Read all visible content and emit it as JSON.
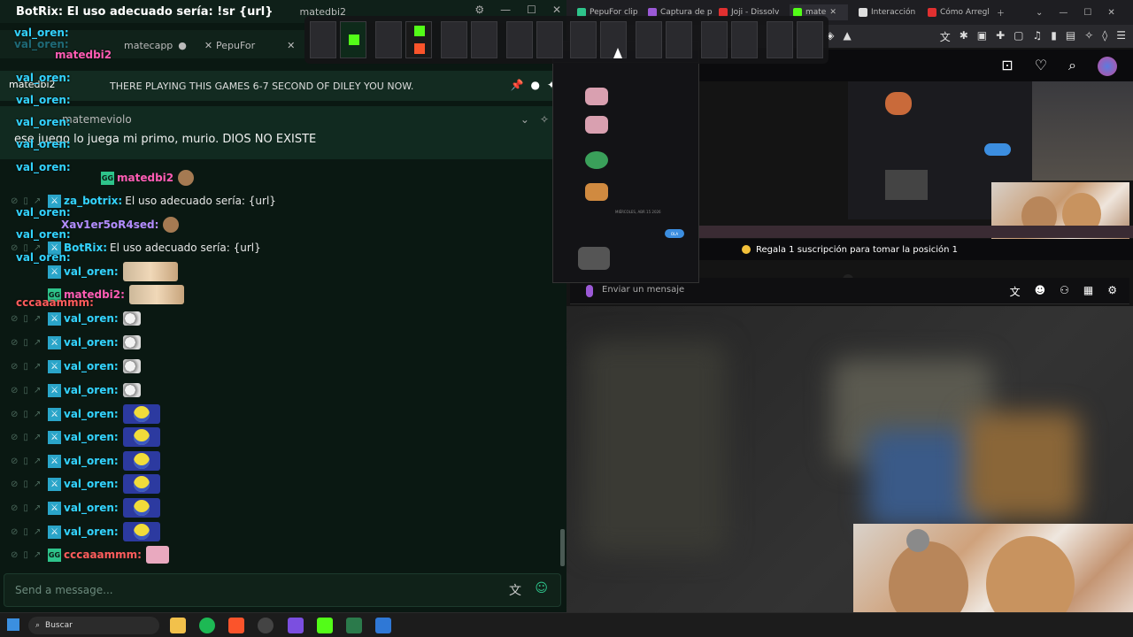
{
  "left_window": {
    "title": "BotRix: El uso adecuado sería: !sr {url}",
    "title_user": "matedbi2",
    "tabs": [
      {
        "label": "matecapp"
      },
      {
        "label": "PepuFor"
      }
    ],
    "pinned": {
      "user": "matedbi2",
      "text": "THERE PLAYING THIS GAMES 6-7 SECOND OF DILEY YOU NOW."
    },
    "banner": {
      "user": "matemeviolo",
      "text": "ese juego lo juega mi primo, murio. DIOS NO EXISTE"
    },
    "overlay_lines": [
      {
        "text": "val_oren:",
        "color": "#33d3ff"
      },
      {
        "text": "val_oren:",
        "color": "#33d3ff"
      },
      {
        "text": "matedbi2",
        "color": "#ff5cb4"
      },
      {
        "text": "val_oren:",
        "color": "#33d3ff"
      },
      {
        "text": "val_oren:",
        "color": "#33d3ff"
      },
      {
        "text": "val_oren:",
        "color": "#33d3ff"
      },
      {
        "text": "val_oren:",
        "color": "#33d3ff"
      },
      {
        "text": "val_oren:",
        "color": "#33d3ff"
      },
      {
        "text": "val_oren:",
        "color": "#33d3ff"
      },
      {
        "text": "val_oren:",
        "color": "#33d3ff"
      },
      {
        "text": "val_oren:",
        "color": "#33d3ff"
      },
      {
        "text": "cccaaammm:",
        "color": "#ff5c5c"
      }
    ],
    "messages": [
      {
        "user": "matedbi2",
        "color": "#ff5cb4",
        "text": "",
        "emote": "emote-ham",
        "badge": "gg"
      },
      {
        "user": "za_botrix:",
        "color": "#33d3ff",
        "text": "El uso adecuado sería: {url}",
        "emote": "",
        "badge": "sword"
      },
      {
        "user": "Xav1er5oR4sed:",
        "color": "#b38cff",
        "text": "",
        "emote": "emote-ham",
        "badge": "none"
      },
      {
        "user": "BotRix:",
        "color": "#33d3ff",
        "text": "El uso adecuado sería: {url}",
        "emote": "",
        "badge": "sword"
      },
      {
        "user": "val_oren:",
        "color": "#33d3ff",
        "text": "",
        "emote": "emote-face",
        "badge": "sword"
      },
      {
        "user": "matedbi2:",
        "color": "#ff5cb4",
        "text": "",
        "emote": "emote-face",
        "badge": "gg"
      },
      {
        "user": "val_oren:",
        "color": "#33d3ff",
        "text": "",
        "emote": "emote-cat",
        "badge": "sword"
      },
      {
        "user": "val_oren:",
        "color": "#33d3ff",
        "text": "",
        "emote": "emote-cat",
        "badge": "sword"
      },
      {
        "user": "val_oren:",
        "color": "#33d3ff",
        "text": "",
        "emote": "emote-cat",
        "badge": "sword"
      },
      {
        "user": "val_oren:",
        "color": "#33d3ff",
        "text": "",
        "emote": "emote-cat",
        "badge": "sword"
      },
      {
        "user": "val_oren:",
        "color": "#33d3ff",
        "text": "",
        "emote": "emote-minion",
        "badge": "sword"
      },
      {
        "user": "val_oren:",
        "color": "#33d3ff",
        "text": "",
        "emote": "emote-minion",
        "badge": "sword"
      },
      {
        "user": "val_oren:",
        "color": "#33d3ff",
        "text": "",
        "emote": "emote-minion",
        "badge": "sword"
      },
      {
        "user": "val_oren:",
        "color": "#33d3ff",
        "text": "",
        "emote": "emote-minion",
        "badge": "sword"
      },
      {
        "user": "val_oren:",
        "color": "#33d3ff",
        "text": "",
        "emote": "emote-minion",
        "badge": "sword"
      },
      {
        "user": "val_oren:",
        "color": "#33d3ff",
        "text": "",
        "emote": "emote-minion",
        "badge": "sword"
      },
      {
        "user": "cccaaammm:",
        "color": "#ff5c5c",
        "text": "",
        "emote": "emote-pig",
        "badge": "gg"
      }
    ],
    "input_placeholder": "Send a message..."
  },
  "browser": {
    "tabs": [
      {
        "label": "PepuFor clip",
        "color": "#2ec48b"
      },
      {
        "label": "Captura de p",
        "color": "#9b59d6"
      },
      {
        "label": "Joji - Dissolv",
        "color": "#e03030"
      },
      {
        "label": "mate",
        "color": "#53fc18"
      },
      {
        "label": "Interacción",
        "color": "#dddddd"
      },
      {
        "label": "Cómo Arregl",
        "color": "#e03030"
      }
    ],
    "sub_banner": "Regala 1 suscripción para tomar la posición 1",
    "chat_placeholder": "Enviar un mensaje",
    "phone_ola": "OLA",
    "phone_date": "MIÉRCOLES, ABR 15 2026"
  },
  "taskbar": {
    "search_placeholder": "Buscar"
  }
}
